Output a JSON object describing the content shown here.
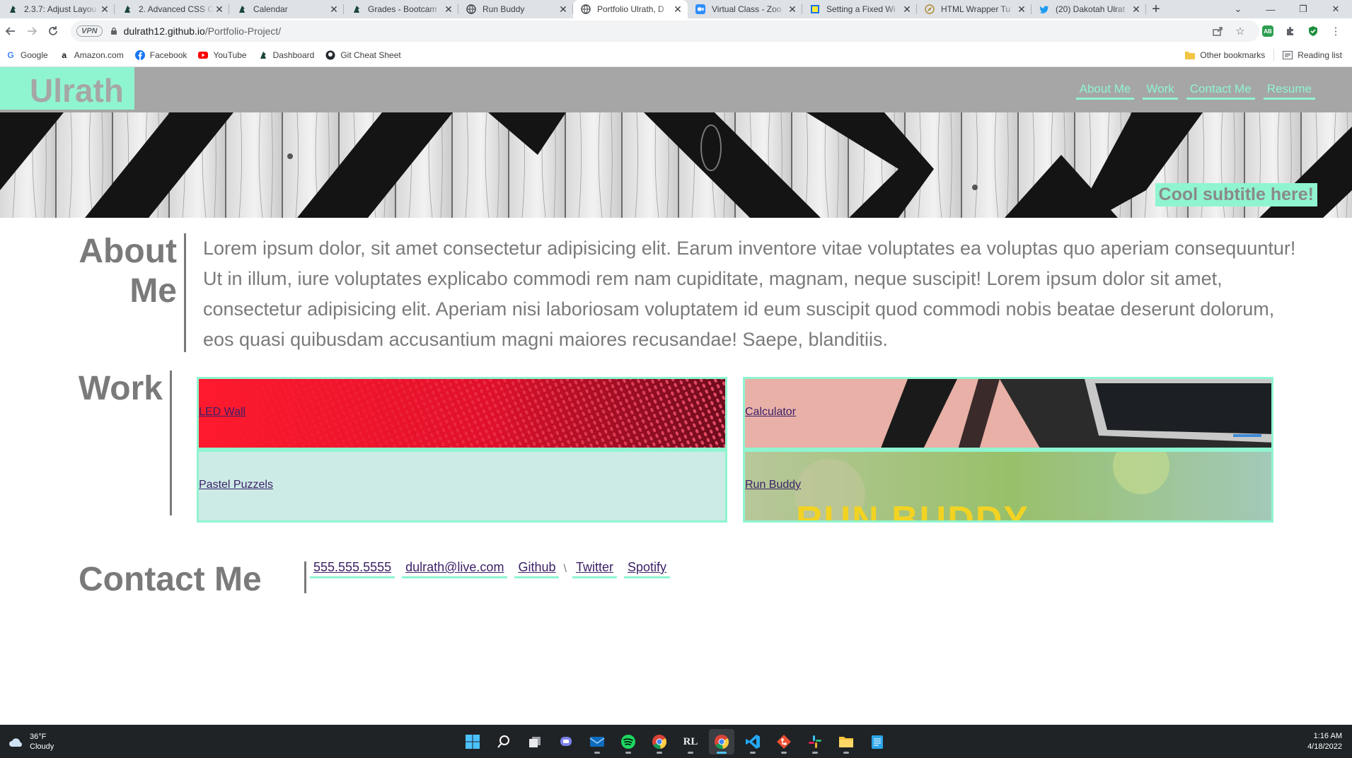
{
  "browser": {
    "tabs": [
      {
        "title": "2.3.7: Adjust Layou",
        "icon": "msu-spartan-icon",
        "active": false
      },
      {
        "title": "2. Advanced CSS C",
        "icon": "msu-spartan-icon",
        "active": false
      },
      {
        "title": "Calendar",
        "icon": "msu-spartan-icon",
        "active": false
      },
      {
        "title": "Grades - Bootcam",
        "icon": "msu-spartan-icon",
        "active": false
      },
      {
        "title": "Run Buddy",
        "icon": "globe-icon",
        "active": false
      },
      {
        "title": "Portfolio Ulrath, D",
        "icon": "globe-icon",
        "active": true
      },
      {
        "title": "Virtual Class - Zoo",
        "icon": "zoom-icon",
        "active": false
      },
      {
        "title": "Setting a Fixed Wi",
        "icon": "doc-icon",
        "active": false
      },
      {
        "title": "HTML Wrapper Tu",
        "icon": "compass-icon",
        "active": false
      },
      {
        "title": "(20) Dakotah Ulrat",
        "icon": "twitter-icon",
        "active": false
      }
    ],
    "address": {
      "vpn_label": "VPN",
      "domain": "dulrath12.github.io",
      "path": "/Portfolio-Project/"
    },
    "bookmarks": [
      {
        "label": "Google",
        "icon": "google-icon"
      },
      {
        "label": "Amazon.com",
        "icon": "amazon-icon"
      },
      {
        "label": "Facebook",
        "icon": "facebook-icon"
      },
      {
        "label": "YouTube",
        "icon": "youtube-icon"
      },
      {
        "label": "Dashboard",
        "icon": "msu-spartan-icon"
      },
      {
        "label": "Git Cheat Sheet",
        "icon": "github-icon"
      }
    ],
    "other_bookmarks": "Other bookmarks",
    "reading_list": "Reading list",
    "extension_badge": "AB"
  },
  "site": {
    "logo": "Ulrath",
    "nav": [
      "About Me",
      "Work",
      "Contact Me",
      "Resume"
    ],
    "subtitle": "Cool subtitle here!",
    "about": {
      "title_line1": "About",
      "title_line2": "Me",
      "text": "Lorem ipsum dolor, sit amet consectetur adipisicing elit. Earum inventore vitae voluptates ea voluptas quo aperiam consequuntur! Ut in illum, iure voluptates explicabo commodi rem nam cupiditate, magnam, neque suscipit! Lorem ipsum dolor sit amet, consectetur adipisicing elit. Aperiam nisi laboriosam voluptatem id eum suscipit quod commodi nobis beatae deserunt dolorum, eos quasi quibusdam accusantium magni maiores recusandae! Saepe, blanditiis."
    },
    "work": {
      "title": "Work",
      "projects": [
        {
          "label": "LED Wall"
        },
        {
          "label": "Calculator"
        },
        {
          "label": "Pastel Puzzels"
        },
        {
          "label": "Run Buddy",
          "image_text": "RUN BUDDY"
        }
      ]
    },
    "contact": {
      "title": "Contact Me",
      "links": [
        "555.555.5555",
        "dulrath@live.com",
        "Github",
        "Twitter",
        "Spotify"
      ],
      "separator": "\\"
    }
  },
  "taskbar": {
    "weather_temp": "36°F",
    "weather_desc": "Cloudy",
    "time": "1:16 AM",
    "date": "4/18/2022",
    "apps": [
      "windows-start-icon",
      "search-icon",
      "task-view-icon",
      "teams-chat-icon",
      "mail-icon",
      "spotify-icon",
      "chrome-icon",
      "rocket-league-icon",
      "chrome-active-icon",
      "vscode-icon",
      "git-icon",
      "slack-icon",
      "file-explorer-icon",
      "notepad-icon"
    ]
  },
  "colors": {
    "accent": "#8ff5d0",
    "header_gray": "#a6a6a6",
    "text_gray": "#7a7a7a",
    "link": "#3a1f66"
  }
}
